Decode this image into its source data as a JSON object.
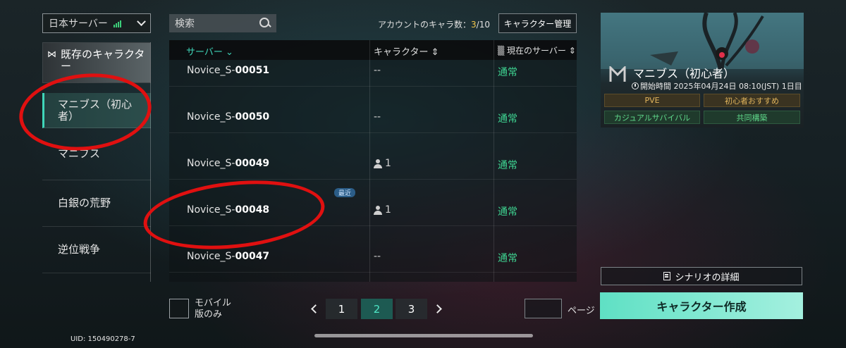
{
  "server_selector": {
    "label": "日本サーバー"
  },
  "search": {
    "placeholder": "検索"
  },
  "account": {
    "count_label": "アカウントのキャラ数：",
    "count_current": "3",
    "count_total": "/10",
    "manage_button": "キャラクター管理"
  },
  "sidebar": {
    "header_label": "既存のキャラクター",
    "items": [
      {
        "label": "マニブス（初心者）",
        "active": true
      },
      {
        "label": "マニブス",
        "active": false
      },
      {
        "label": "白銀の荒野",
        "active": false
      },
      {
        "label": "逆位戦争",
        "active": false
      }
    ]
  },
  "table": {
    "headers": {
      "server": "サーバー",
      "character": "キャラクター",
      "status": "現在のサーバー"
    },
    "rows": [
      {
        "name_prefix": "Novice_S-",
        "name_num": "00051",
        "characters": "--",
        "status": "通常"
      },
      {
        "name_prefix": "Novice_S-",
        "name_num": "00050",
        "characters": "--",
        "status": "通常"
      },
      {
        "name_prefix": "Novice_S-",
        "name_num": "00049",
        "characters": "1",
        "status": "通常"
      },
      {
        "name_prefix": "Novice_S-",
        "name_num": "00048",
        "characters": "1",
        "status": "通常",
        "badge": "最近"
      },
      {
        "name_prefix": "Novice_S-",
        "name_num": "00047",
        "characters": "--",
        "status": "通常"
      }
    ]
  },
  "pagination": {
    "mobile_only_label": "モバイル版のみ",
    "pages": [
      "1",
      "2",
      "3"
    ],
    "current_page": "2",
    "page_label": "ページ"
  },
  "scenario": {
    "title": "マニブス（初心者）",
    "time_text": "開始時間 2025年04月24日 08:10(JST) 1日目",
    "tags": [
      "PVE",
      "初心者おすすめ",
      "カジュアルサバイバル",
      "共同構築"
    ],
    "detail_button": "シナリオの詳細",
    "create_button": "キャラクター作成"
  },
  "uid": "UID: 150490278-7",
  "colors": {
    "accent": "#3fd5b9",
    "status_green": "#3fd592",
    "gold": "#e0b45c",
    "annotation_red": "#e01010"
  }
}
